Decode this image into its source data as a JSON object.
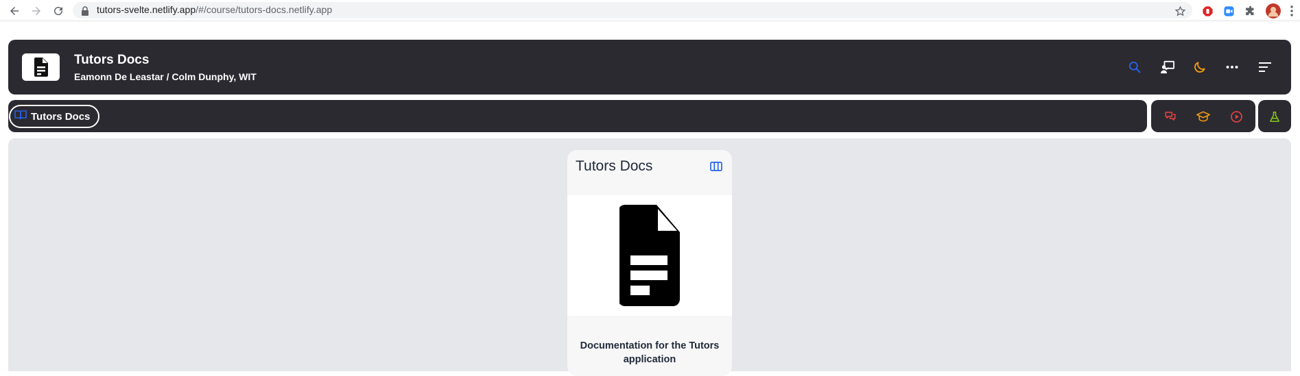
{
  "browser": {
    "url_host": "tutors-svelte.netlify.app",
    "url_path": "/#/course/tutors-docs.netlify.app",
    "icons": [
      "back-icon",
      "forward-icon",
      "reload-icon",
      "lock-icon",
      "star-icon"
    ],
    "extensions": [
      "adblock-extension-icon",
      "zoom-extension-icon",
      "puzzle-extensions-icon",
      "profile-avatar",
      "more-menu-icon"
    ]
  },
  "header": {
    "title": "Tutors Docs",
    "subtitle": "Eamonn De Leastar / Colm Dunphy, WIT",
    "icons": {
      "search": {
        "name": "search-icon",
        "color": "#2563eb"
      },
      "presenter": {
        "name": "presenter-icon",
        "color": "#ffffff"
      },
      "theme": {
        "name": "moon-icon",
        "color": "#f59e0b"
      },
      "more": {
        "name": "ellipsis-icon",
        "color": "#ffffff"
      },
      "menu": {
        "name": "menu-icon",
        "color": "#ffffff"
      }
    }
  },
  "subnav": {
    "breadcrumb_label": "Tutors Docs",
    "breadcrumb_icon": "book-icon",
    "right_icons": [
      {
        "name": "chat-icon",
        "color": "#ef4444"
      },
      {
        "name": "graduation-cap-icon",
        "color": "#f59e0b"
      },
      {
        "name": "play-circle-icon",
        "color": "#ef4444"
      },
      {
        "name": "lab-flask-icon",
        "color": "#84cc16"
      }
    ]
  },
  "card": {
    "title": "Tutors Docs",
    "open_icon": "columns-icon",
    "image_icon": "document-icon",
    "description": "Documentation for the Tutors application"
  },
  "colors": {
    "bar_bg": "#2c2a31",
    "main_bg": "#e5e7eb",
    "accent_blue": "#2563eb"
  }
}
